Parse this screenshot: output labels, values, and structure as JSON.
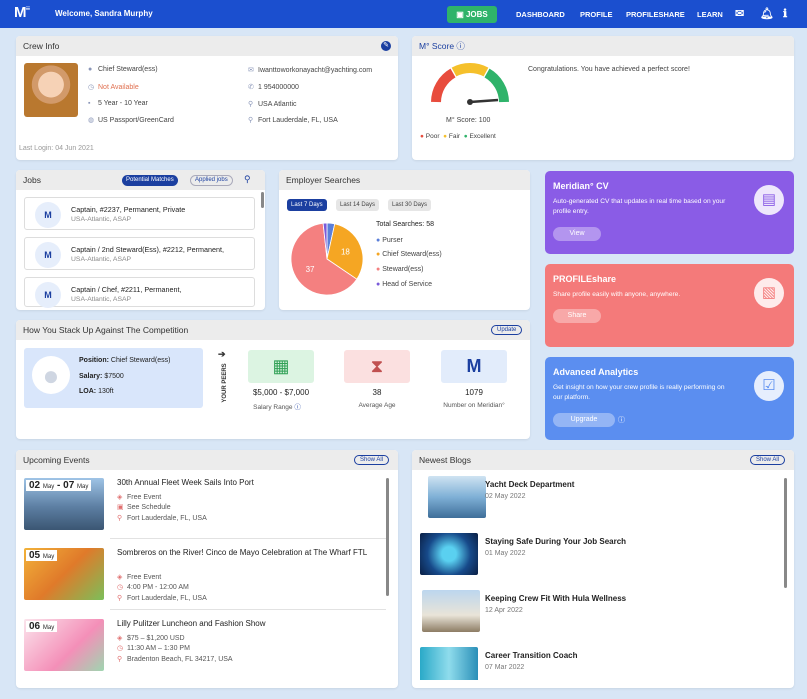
{
  "nav": {
    "logo": "M",
    "logo_sup": "≡",
    "welcome": "Welcome, Sandra Murphy",
    "jobs": "JOBS",
    "dashboard": "DASHBOARD",
    "profile": "PROFILE",
    "profileshare": "PROFILESHARE",
    "learn": "LEARN"
  },
  "crew": {
    "title": "Crew Info",
    "position": "Chief Steward(ess)",
    "availability": "Not Available",
    "experience": "5 Year - 10 Year",
    "passport": "US Passport/GreenCard",
    "email": "Iwanttoworkonayacht@yachting.com",
    "phone": "1 954000000",
    "region": "USA Atlantic",
    "location": "Fort Lauderdale, FL, USA",
    "last_login_label": "Last Login:",
    "last_login": "04 Jun 2021"
  },
  "score": {
    "title": "M° Score",
    "congrats": "Congratulations. You have achieved a perfect score!",
    "value_label": "M° Score: 100",
    "value": 100,
    "legend": [
      "Poor",
      "Fair",
      "Excellent"
    ],
    "colors": [
      "#e84c3d",
      "#f5c02b",
      "#2fb36a"
    ]
  },
  "jobs": {
    "title": "Jobs",
    "tab_potential": "Potential Matches",
    "tab_applied": "Applied jobs",
    "items": [
      {
        "logo": "M",
        "title": "Captain, #2237, Permanent, Private",
        "sub": "USA-Atlantic, ASAP"
      },
      {
        "logo": "M",
        "title": "Captain / 2nd Steward(Ess), #2212, Permanent,",
        "sub": "USA-Atlantic, ASAP"
      },
      {
        "logo": "M",
        "title": "Captain / Chef, #2211, Permanent,",
        "sub": "USA-Atlantic, ASAP"
      }
    ]
  },
  "employer": {
    "title": "Employer Searches",
    "tabs": [
      "Last 7 Days",
      "Last 14 Days",
      "Last 30 Days"
    ],
    "total": "Total Searches: 58",
    "legend": [
      "Purser",
      "Chief Steward(ess)",
      "Steward(ess)",
      "Head of Service"
    ]
  },
  "chart_data": {
    "type": "pie",
    "title": "",
    "categories": [
      "Purser",
      "Chief Steward(ess)",
      "Steward(ess)",
      "Head of Service"
    ],
    "values": [
      2,
      18,
      37,
      1
    ],
    "labels": [
      "",
      "18",
      "37",
      ""
    ],
    "colors": [
      "#5b7fd9",
      "#f5a623",
      "#f48080",
      "#7a5bd9"
    ]
  },
  "stack": {
    "title": "How You Stack Up Against The Competition",
    "update": "Update",
    "position_label": "Position:",
    "position": "Chief Steward(ess)",
    "salary_label": "Salary:",
    "salary": "$7500",
    "loa_label": "LOA:",
    "loa": "130ft",
    "peers": "YOUR PEERS",
    "salary_range": "$5,000 - $7,000",
    "salary_range_label": "Salary Range",
    "avg_age": "38",
    "avg_age_label": "Average Age",
    "number": "1079",
    "number_label": "Number on Meridian°"
  },
  "cv": {
    "title": "Meridian° CV",
    "text": "Auto-generated CV that updates in real time based on your profile entry.",
    "button": "View"
  },
  "share": {
    "title": "PROFILEshare",
    "text": "Share profile easily with anyone, anywhere.",
    "button": "Share"
  },
  "analytics": {
    "title": "Advanced Analytics",
    "text": "Get insight on how your crew profile is really performing on our platform.",
    "button": "Upgrade"
  },
  "events": {
    "title": "Upcoming Events",
    "show_all": "Show All",
    "items": [
      {
        "day": "02",
        "month": "May",
        "day2": "07",
        "month2": "May",
        "title": "30th Annual Fleet Week Sails Into Port",
        "price": "Free Event",
        "time": "See Schedule",
        "location": "Fort Lauderdale, FL, USA"
      },
      {
        "day": "05",
        "month": "May",
        "title": "Sombreros on the River! Cinco de Mayo Celebration at The Wharf FTL",
        "price": "Free Event",
        "time": "4:00 PM - 12:00 AM",
        "location": "Fort Lauderdale, FL, USA"
      },
      {
        "day": "06",
        "month": "May",
        "title": "Lilly Pulitzer Luncheon and Fashion Show",
        "price": "$75 – $1,200 USD",
        "time": "11:30 AM – 1:30 PM",
        "location": "Bradenton Beach, FL 34217, USA"
      }
    ]
  },
  "blogs": {
    "title": "Newest Blogs",
    "show_all": "Show All",
    "items": [
      {
        "title": "Yacht Deck Department",
        "date": "02 May 2022"
      },
      {
        "title": "Staying Safe During Your Job Search",
        "date": "01 May 2022"
      },
      {
        "title": "Keeping Crew Fit With Hula Wellness",
        "date": "12 Apr 2022"
      },
      {
        "title": "Career Transition Coach",
        "date": "07 Mar 2022"
      }
    ]
  }
}
